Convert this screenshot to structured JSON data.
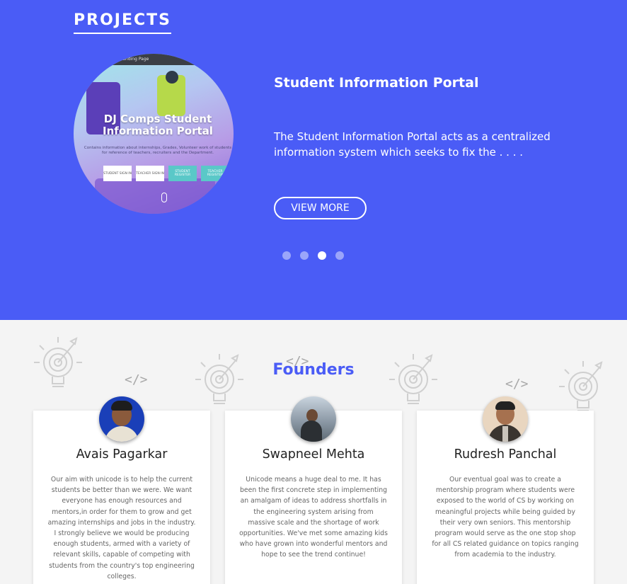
{
  "projects": {
    "heading": "PROJECTS",
    "thumbnail": {
      "window_label": "Landing Page",
      "title": "DJ Comps Student Information Portal",
      "subtitle": "Contains information about internships, Grades, Volunteer work of students for reference of teachers, recruiters and the Department.",
      "buttons": [
        "STUDENT SIGN IN",
        "TEACHER SIGN IN",
        "STUDENT REGISTER",
        "TEACHER REGISTER"
      ]
    },
    "title": "Student Information Portal",
    "description": "The Student Information Portal acts as a centralized information system which seeks to fix the . . . .",
    "view_more_label": "VIEW MORE",
    "carousel": {
      "count": 4,
      "active_index": 2
    },
    "colors": {
      "background": "#4a5cf6",
      "text": "#ffffff"
    }
  },
  "founders": {
    "heading": "Founders",
    "heading_color": "#4a5cf6",
    "cards": [
      {
        "name": "Avais Pagarkar",
        "text": "Our aim with unicode is to help the current students be better than we were. We want everyone has enough resources and mentors,in order for them to grow and get amazing internships and jobs in the industry. I strongly believe we would be producing enough students, armed with a variety of relevant skills, capable of competing with students from the country's top engineering colleges."
      },
      {
        "name": "Swapneel Mehta",
        "text": "Unicode means a huge deal to me. It has been the first concrete step in implementing an amalgam of ideas to address shortfalls in the engineering system arising from massive scale and the shortage of work opportunities. We've met some amazing kids who have grown into wonderful mentors and hope to see the trend continue!"
      },
      {
        "name": "Rudresh Panchal",
        "text": "Our eventual goal was to create a mentorship program where students were exposed to the world of CS by working on meaningful projects while being guided by their very own seniors. This mentorship program would serve as the one stop shop for all CS related guidance on topics ranging from academia to the industry."
      }
    ],
    "decorations": {
      "code_icon_glyph": "</>",
      "bulb_icon": "lightbulb-target-icon"
    }
  }
}
